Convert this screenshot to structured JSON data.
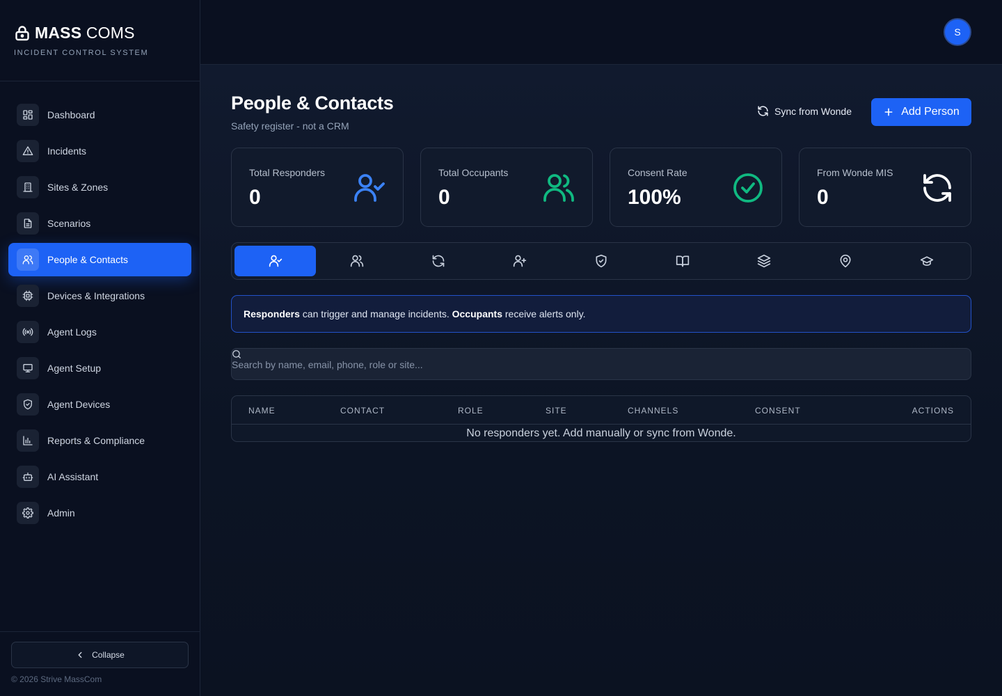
{
  "brand": {
    "name_bold": "MASS",
    "name_light": "COMS",
    "subtitle": "INCIDENT CONTROL SYSTEM"
  },
  "sidebar": {
    "items": [
      {
        "label": "Dashboard",
        "icon": "grid-icon"
      },
      {
        "label": "Incidents",
        "icon": "alert-triangle-icon"
      },
      {
        "label": "Sites & Zones",
        "icon": "building-icon"
      },
      {
        "label": "Scenarios",
        "icon": "file-text-icon"
      },
      {
        "label": "People & Contacts",
        "icon": "users-icon",
        "active": true
      },
      {
        "label": "Devices & Integrations",
        "icon": "chip-icon"
      },
      {
        "label": "Agent Logs",
        "icon": "radio-icon"
      },
      {
        "label": "Agent Setup",
        "icon": "monitor-icon"
      },
      {
        "label": "Agent Devices",
        "icon": "shield-icon"
      },
      {
        "label": "Reports & Compliance",
        "icon": "bar-chart-icon"
      },
      {
        "label": "AI Assistant",
        "icon": "bot-icon"
      },
      {
        "label": "Admin",
        "icon": "gear-icon"
      }
    ],
    "collapse_label": "Collapse",
    "copyright": "© 2026 Strive MassCom"
  },
  "topbar": {
    "avatar_initial": "S"
  },
  "header": {
    "title": "People & Contacts",
    "subtitle": "Safety register - not a CRM",
    "sync_label": "Sync from Wonde",
    "add_label": "Add Person"
  },
  "stats": [
    {
      "label": "Total Responders",
      "value": "0",
      "icon": "user-check-icon",
      "color": "#3b82f6"
    },
    {
      "label": "Total Occupants",
      "value": "0",
      "icon": "users-icon",
      "color": "#10b981"
    },
    {
      "label": "Consent Rate",
      "value": "100%",
      "icon": "check-circle-icon",
      "color": "#10b981"
    },
    {
      "label": "From Wonde MIS",
      "value": "0",
      "icon": "refresh-icon",
      "color": "#ffffff"
    }
  ],
  "tabs": [
    {
      "icon": "user-check-icon",
      "active": true
    },
    {
      "icon": "users-icon"
    },
    {
      "icon": "refresh-icon"
    },
    {
      "icon": "user-plus-icon"
    },
    {
      "icon": "shield-check-icon"
    },
    {
      "icon": "book-open-icon"
    },
    {
      "icon": "layers-icon"
    },
    {
      "icon": "map-pin-icon"
    },
    {
      "icon": "graduation-cap-icon"
    }
  ],
  "info": {
    "responders": "Responders",
    "responders_text": " can trigger and manage incidents. ",
    "occupants": "Occupants",
    "occupants_text": " receive alerts only."
  },
  "search": {
    "placeholder": "Search by name, email, phone, role or site..."
  },
  "table": {
    "columns": [
      "NAME",
      "CONTACT",
      "ROLE",
      "SITE",
      "CHANNELS",
      "CONSENT",
      "ACTIONS"
    ],
    "empty_message": "No responders yet. Add manually or sync from Wonde."
  },
  "colors": {
    "accent": "#1d62f5",
    "background": "#0b1222",
    "sidebar": "#0a1020"
  }
}
